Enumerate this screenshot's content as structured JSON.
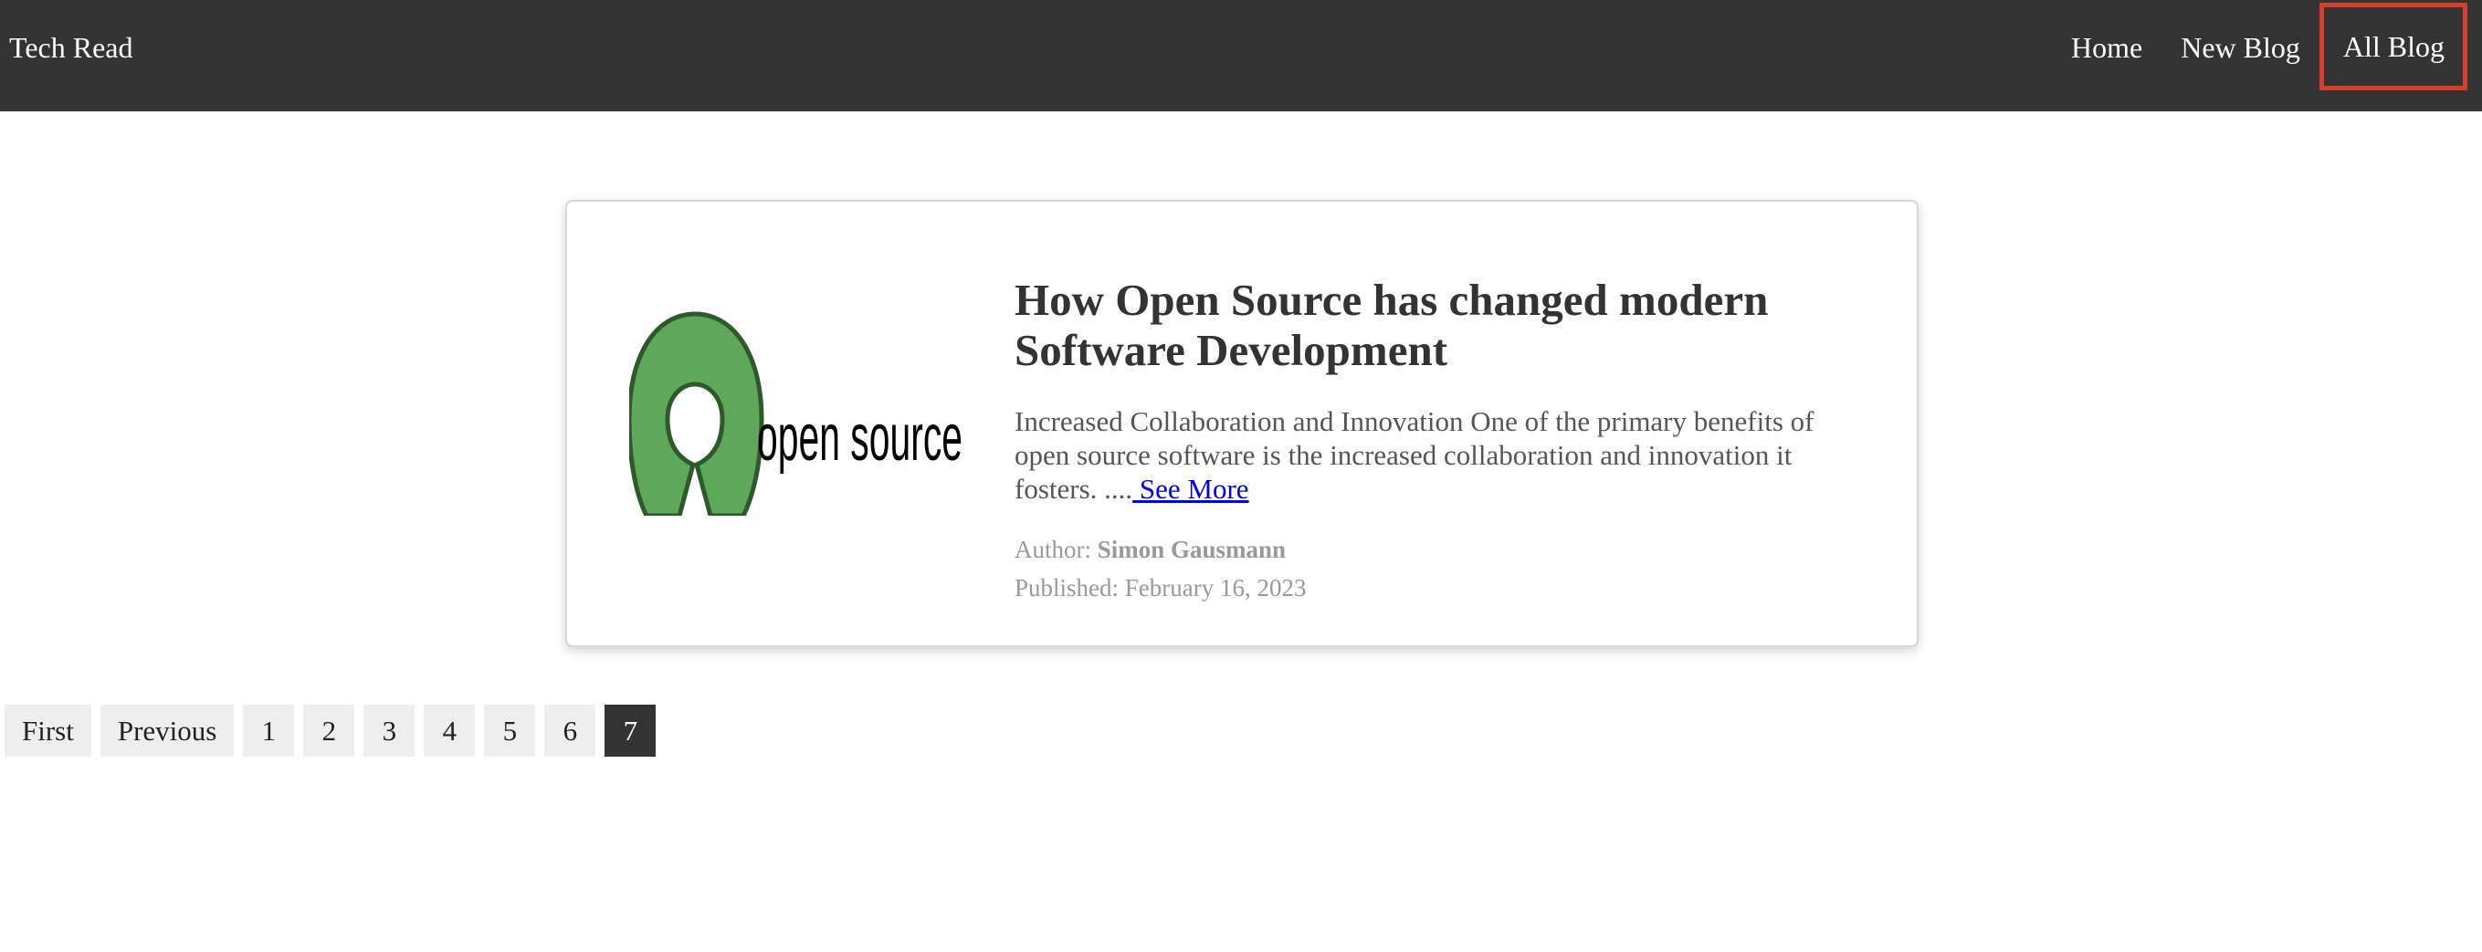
{
  "navbar": {
    "brand": "Tech Read",
    "links": [
      {
        "label": "Home"
      },
      {
        "label": "New Blog"
      },
      {
        "label": "All Blog"
      }
    ]
  },
  "post": {
    "title": "How Open Source has changed modern Software Development",
    "excerpt": "Increased Collaboration and Innovation One of the primary benefits of open source software is the increased collaboration and innovation it fosters. ....",
    "see_more": " See More",
    "author_label": "Author: ",
    "author_name": "Simon Gausmann",
    "published": "Published: February 16, 2023",
    "image_text": "open source"
  },
  "pagination": {
    "first": "First",
    "previous": "Previous",
    "pages": [
      "1",
      "2",
      "3",
      "4",
      "5",
      "6",
      "7"
    ],
    "current": "7"
  },
  "colors": {
    "navbar_bg": "#333333",
    "active_outline": "#d4402c",
    "link": "#0000ee",
    "logo_green": "#5fa85a"
  }
}
